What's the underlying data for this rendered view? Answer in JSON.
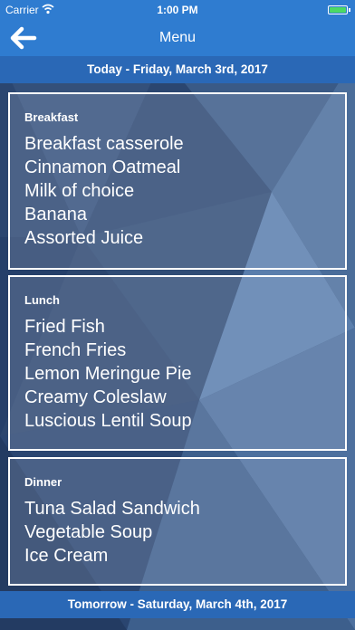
{
  "status": {
    "carrier": "Carrier",
    "time": "1:00 PM"
  },
  "nav": {
    "title": "Menu"
  },
  "days": [
    {
      "header": "Today - Friday, March 3rd, 2017"
    },
    {
      "header": "Tomorrow - Saturday, March 4th, 2017"
    }
  ],
  "meals": {
    "breakfast": {
      "title": "Breakfast",
      "items": [
        "Breakfast casserole",
        "Cinnamon Oatmeal",
        "Milk of choice",
        "Banana",
        "Assorted Juice"
      ]
    },
    "lunch": {
      "title": "Lunch",
      "items": [
        "Fried Fish",
        "French Fries",
        "Lemon Meringue Pie",
        "Creamy Coleslaw",
        "Luscious Lentil Soup"
      ]
    },
    "dinner": {
      "title": "Dinner",
      "items": [
        "Tuna Salad Sandwich",
        "Vegetable Soup",
        "Ice Cream"
      ]
    }
  },
  "colors": {
    "bar": "#2f7cd0",
    "day_header": "#2a68b6",
    "background": "#2e4a72"
  },
  "icons": {
    "back": "arrow-left-icon",
    "wifi": "wifi-icon",
    "battery": "battery-icon"
  }
}
